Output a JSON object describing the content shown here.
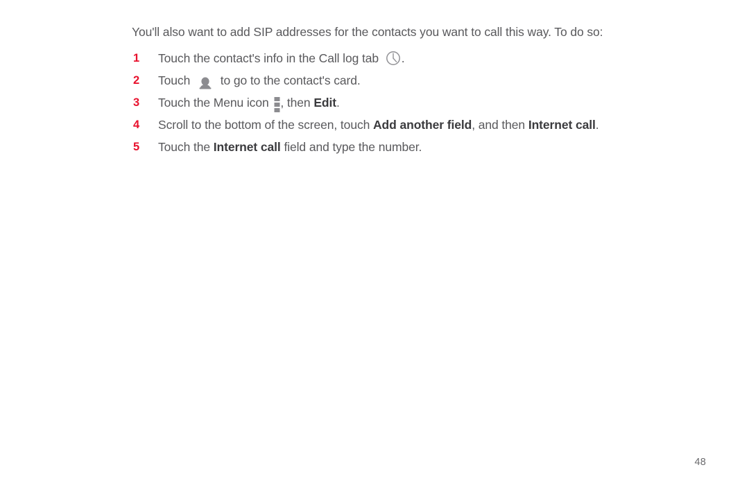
{
  "document": {
    "intro_text": "You'll also want to add SIP addresses for the contacts you want to call this way. To do so:",
    "page_number": "48",
    "colors": {
      "step_number": "#e8112d",
      "body_text": "#59595c",
      "bold_text": "#3b3b3e",
      "icon_gray": "#8c8c90",
      "background": "#ffffff"
    },
    "steps": [
      {
        "number": "1",
        "parts": [
          {
            "type": "text",
            "value": "Touch the contact's info in the Call log tab "
          },
          {
            "type": "icon",
            "name": "clock-icon"
          },
          {
            "type": "text",
            "value": "."
          }
        ],
        "plain": "Touch the contact's info in the Call log tab (clock icon)."
      },
      {
        "number": "2",
        "parts": [
          {
            "type": "text",
            "value": "Touch "
          },
          {
            "type": "icon",
            "name": "person-icon"
          },
          {
            "type": "text",
            "value": " to go to the contact's card."
          }
        ],
        "plain": "Touch (person icon) to go to the contact's card."
      },
      {
        "number": "3",
        "parts": [
          {
            "type": "text",
            "value": "Touch the Menu icon "
          },
          {
            "type": "icon",
            "name": "overflow-menu-icon"
          },
          {
            "type": "text",
            "value": ", then "
          },
          {
            "type": "bold",
            "value": "Edit"
          },
          {
            "type": "text",
            "value": "."
          }
        ],
        "plain": "Touch the Menu icon (overflow menu), then Edit."
      },
      {
        "number": "4",
        "parts": [
          {
            "type": "text",
            "value": "Scroll to the bottom of the screen, touch "
          },
          {
            "type": "bold",
            "value": "Add another field"
          },
          {
            "type": "text",
            "value": ", and then "
          },
          {
            "type": "bold",
            "value": "Internet call"
          },
          {
            "type": "text",
            "value": "."
          }
        ],
        "plain": "Scroll to the bottom of the screen, touch Add another field, and then Internet call."
      },
      {
        "number": "5",
        "parts": [
          {
            "type": "text",
            "value": "Touch the "
          },
          {
            "type": "bold",
            "value": "Internet call"
          },
          {
            "type": "text",
            "value": " field and type the number."
          }
        ],
        "plain": "Touch the Internet call field and type the number."
      }
    ]
  }
}
